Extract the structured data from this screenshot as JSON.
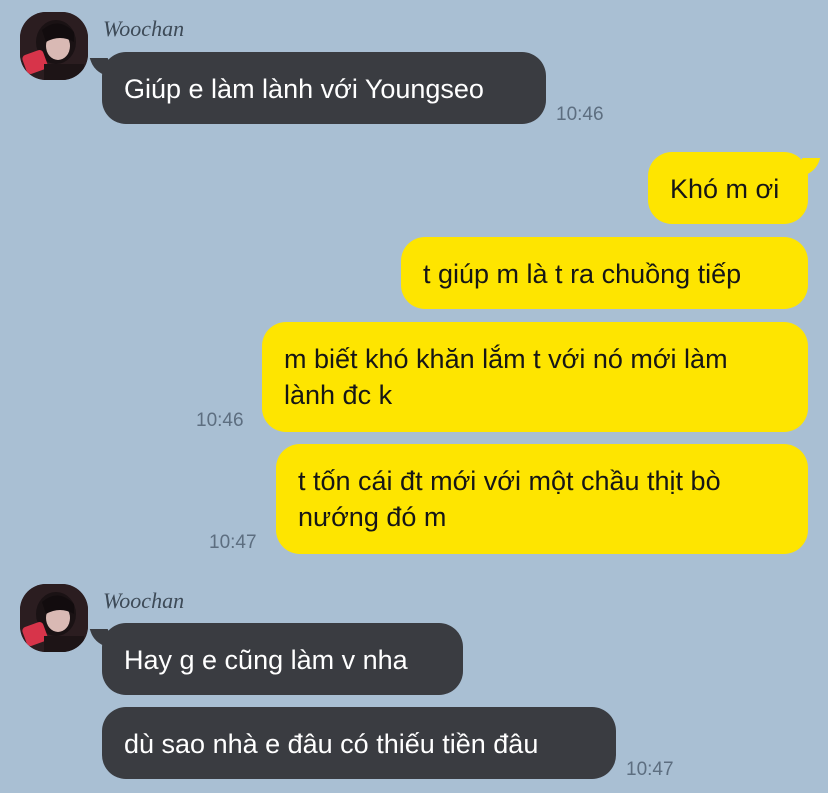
{
  "colors": {
    "background": "#A9BFD3",
    "incoming_bubble": "#3A3C41",
    "outgoing_bubble": "#FEE500",
    "timestamp": "#5d6e80"
  },
  "groups": [
    {
      "sender": "Woochan",
      "avatar_icon": "profile-photo",
      "messages": [
        {
          "text": "Giúp e làm lành với Youngseo",
          "time": "10:46"
        }
      ]
    },
    {
      "sender": "me",
      "messages": [
        {
          "text": "Khó m ơi",
          "time": ""
        },
        {
          "text": "t giúp m là t ra chuồng tiếp",
          "time": ""
        },
        {
          "text": "m biết khó khăn lắm t với nó mới làm lành đc k",
          "time": "10:46"
        },
        {
          "text": "t tốn cái đt mới với một chầu thịt bò nướng đó m",
          "time": "10:47"
        }
      ]
    },
    {
      "sender": "Woochan",
      "avatar_icon": "profile-photo",
      "messages": [
        {
          "text": "Hay g e cũng làm v nha",
          "time": ""
        },
        {
          "text": "dù sao nhà e đâu có thiếu tiền đâu",
          "time": "10:47"
        }
      ]
    }
  ]
}
